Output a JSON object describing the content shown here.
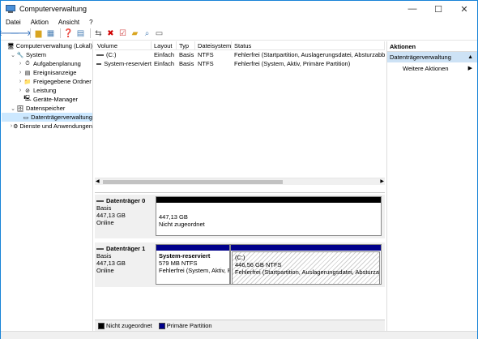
{
  "window": {
    "title": "Computerverwaltung"
  },
  "controls": {
    "minimize": "—",
    "maximize": "☐",
    "close": "✕"
  },
  "menu": [
    "Datei",
    "Aktion",
    "Ansicht",
    "?"
  ],
  "tree": [
    {
      "label": "Computerverwaltung (Lokal)",
      "indent": 0,
      "exp": "",
      "icon": "computer-icon",
      "glyph": "🖥"
    },
    {
      "label": "System",
      "indent": 1,
      "exp": "⌄",
      "icon": "tools-icon",
      "glyph": "🔧"
    },
    {
      "label": "Aufgabenplanung",
      "indent": 2,
      "exp": "›",
      "icon": "clock-icon",
      "glyph": "⏱"
    },
    {
      "label": "Ereignisanzeige",
      "indent": 2,
      "exp": "›",
      "icon": "event-viewer-icon",
      "glyph": "▤"
    },
    {
      "label": "Freigegebene Ordner",
      "indent": 2,
      "exp": "›",
      "icon": "shared-folder-icon",
      "glyph": "📁"
    },
    {
      "label": "Leistung",
      "indent": 2,
      "exp": "›",
      "icon": "performance-icon",
      "glyph": "⊘"
    },
    {
      "label": "Geräte-Manager",
      "indent": 2,
      "exp": "",
      "icon": "device-manager-icon",
      "glyph": "🖳"
    },
    {
      "label": "Datenspeicher",
      "indent": 1,
      "exp": "⌄",
      "icon": "storage-icon",
      "glyph": "🗄"
    },
    {
      "label": "Datenträgerverwaltung",
      "indent": 2,
      "exp": "",
      "icon": "disk-management-icon",
      "glyph": "▭",
      "selected": true
    },
    {
      "label": "Dienste und Anwendungen",
      "indent": 1,
      "exp": "›",
      "icon": "services-icon",
      "glyph": "⚙"
    }
  ],
  "volumes": {
    "headers": [
      "Volume",
      "Layout",
      "Typ",
      "Dateisystem",
      "Status"
    ],
    "rows": [
      [
        "(C:)",
        "Einfach",
        "Basis",
        "NTFS",
        "Fehlerfrei (Startpartition, Auslagerungsdatei, Absturzabbild"
      ],
      [
        "System-reserviert",
        "Einfach",
        "Basis",
        "NTFS",
        "Fehlerfrei (System, Aktiv, Primäre Partition)"
      ]
    ]
  },
  "disks": [
    {
      "name": "Datenträger 0",
      "type": "Basis",
      "size": "447,13 GB",
      "status": "Online",
      "partitions": [
        {
          "name": "",
          "size": "447,13 GB",
          "status": "Nicht zugeordnet"
        }
      ]
    },
    {
      "name": "Datenträger 1",
      "type": "Basis",
      "size": "447,13 GB",
      "status": "Online",
      "partitions": [
        {
          "name": "System-reserviert",
          "size": "579 MB NTFS",
          "status": "Fehlerfrei (System, Aktiv, P"
        },
        {
          "name": "(C:)",
          "size": "446,56 GB NTFS",
          "status": "Fehlerfrei (Startpartition, Auslagerungsdatei, Absturzabbil"
        }
      ]
    }
  ],
  "legend": [
    {
      "label": "Nicht zugeordnet",
      "color": "#000000"
    },
    {
      "label": "Primäre Partition",
      "color": "#00008b"
    }
  ],
  "actions": {
    "title": "Aktionen",
    "section": "Datenträgerverwaltung",
    "item": "Weitere Aktionen"
  },
  "colors": {
    "unallocated": "#000000",
    "primary": "#00008b",
    "selection": "#cce8ff",
    "accent": "#1883d7"
  }
}
